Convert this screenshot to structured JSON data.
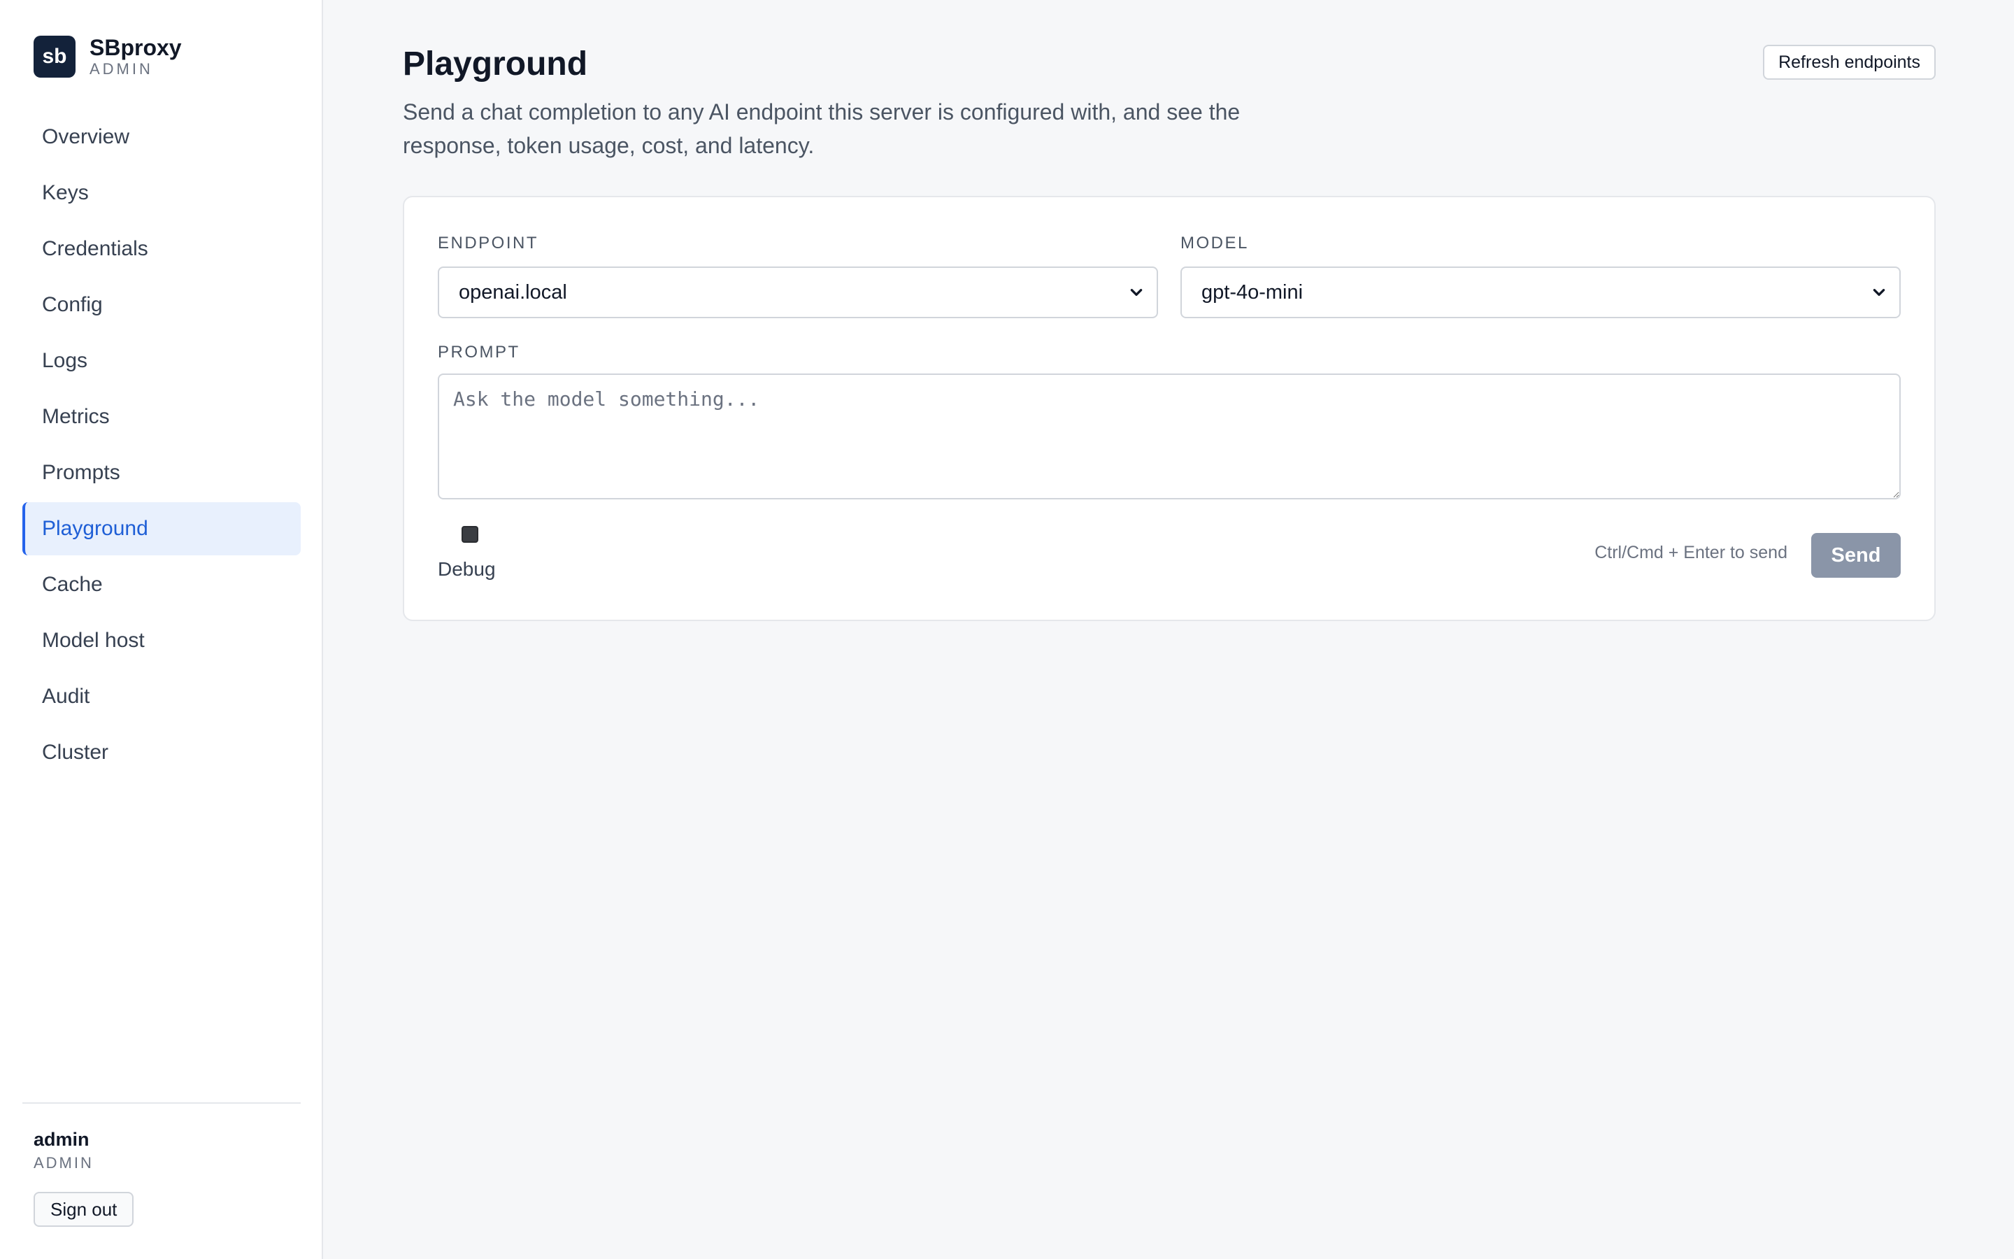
{
  "brand": {
    "logo_text": "sb",
    "name": "SBproxy",
    "subtitle": "ADMIN"
  },
  "sidebar": {
    "items": [
      {
        "label": "Overview",
        "active": false
      },
      {
        "label": "Keys",
        "active": false
      },
      {
        "label": "Credentials",
        "active": false
      },
      {
        "label": "Config",
        "active": false
      },
      {
        "label": "Logs",
        "active": false
      },
      {
        "label": "Metrics",
        "active": false
      },
      {
        "label": "Prompts",
        "active": false
      },
      {
        "label": "Playground",
        "active": true
      },
      {
        "label": "Cache",
        "active": false
      },
      {
        "label": "Model host",
        "active": false
      },
      {
        "label": "Audit",
        "active": false
      },
      {
        "label": "Cluster",
        "active": false
      }
    ],
    "user": {
      "name": "admin",
      "role": "ADMIN"
    },
    "sign_out_label": "Sign out"
  },
  "header": {
    "title": "Playground",
    "description": "Send a chat completion to any AI endpoint this server is configured with, and see the response, token usage, cost, and latency.",
    "refresh_label": "Refresh endpoints"
  },
  "form": {
    "endpoint_label": "ENDPOINT",
    "endpoint_value": "openai.local",
    "model_label": "MODEL",
    "model_value": "gpt-4o-mini",
    "prompt_label": "PROMPT",
    "prompt_placeholder": "Ask the model something...",
    "debug_label": "Debug",
    "hint": "Ctrl/Cmd + Enter to send",
    "send_label": "Send"
  },
  "colors": {
    "accent": "#2563eb",
    "logo_bg": "#13223a",
    "send_disabled": "#8a95a8"
  },
  "icons": {
    "select_indicator": "chevron-down-icon"
  }
}
